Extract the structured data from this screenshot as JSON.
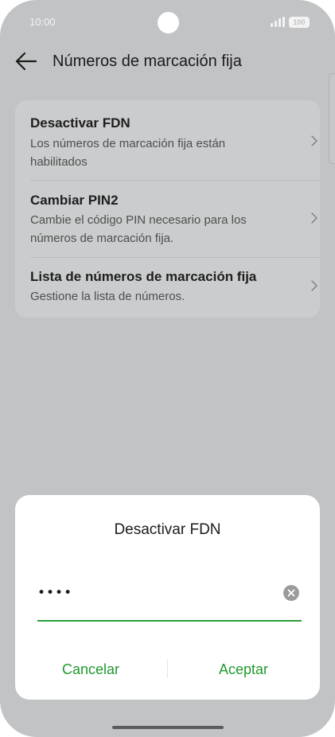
{
  "status_bar": {
    "time": "10:00",
    "battery": "100",
    "signal_icon": "cellular-signal-icon",
    "battery_icon": "battery-icon"
  },
  "header": {
    "back_icon": "arrow-left-icon",
    "title": "Números de marcación fija"
  },
  "settings": {
    "items": [
      {
        "title": "Desactivar FDN",
        "description": "Los números de marcación fija están habilitados"
      },
      {
        "title": "Cambiar PIN2",
        "description": "Cambie el código PIN necesario para los números de marcación fija."
      },
      {
        "title": "Lista de números de marcación fija",
        "description": "Gestione la lista de números."
      }
    ]
  },
  "dialog": {
    "title": "Desactivar FDN",
    "pin_value": "••••",
    "clear_icon": "clear-circle-icon",
    "cancel_label": "Cancelar",
    "accept_label": "Aceptar"
  },
  "colors": {
    "accent": "#1f9a2e",
    "scrim_background": "#c2c3c5",
    "card_background": "#cbcccd"
  }
}
